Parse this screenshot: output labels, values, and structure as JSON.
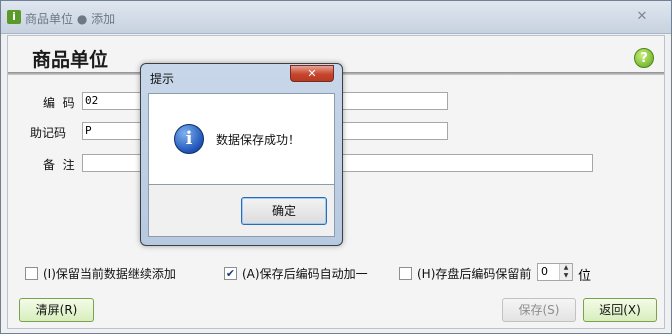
{
  "window": {
    "title": "商品单位 ● 添加",
    "app_icon": "i",
    "close_glyph": "✕"
  },
  "page": {
    "title": "商品单位",
    "help_glyph": "?"
  },
  "form": {
    "code_label": "编  码",
    "code_value": "02",
    "mnemonic_label": "助记码",
    "mnemonic_value": "P",
    "remark_label": "备  注",
    "remark_value": ""
  },
  "options": {
    "keep_adding": {
      "label": "(I)保留当前数据继续添加",
      "checked": false
    },
    "auto_increment": {
      "label": "(A)保存后编码自动加一",
      "checked": true
    },
    "keep_prefix": {
      "label": "(H)存盘后编码保留前",
      "checked": false
    },
    "prefix_count": "0",
    "unit_label": "位"
  },
  "buttons": {
    "clear": "清屏(R)",
    "save": "保存(S)",
    "back": "返回(X)"
  },
  "dialog": {
    "title": "提示",
    "message": "数据保存成功！",
    "ok": "确定",
    "close_glyph": "✕",
    "info_glyph": "i"
  },
  "colors": {
    "accent_green": "#7aa24a",
    "help_green": "#5ea41c",
    "info_blue": "#1f54b8",
    "close_red": "#c7452d"
  }
}
